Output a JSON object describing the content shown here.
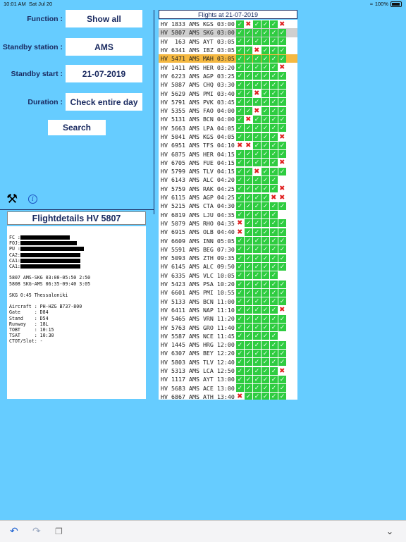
{
  "status": {
    "time": "10:01 AM",
    "date": "Sat Jul 20",
    "battery": "100%"
  },
  "form": {
    "function_label": "Function :",
    "function_value": "Show all",
    "station_label": "Standby station :",
    "station_value": "AMS",
    "start_label": "Standby start :",
    "start_value": "21-07-2019",
    "duration_label": "Duration :",
    "duration_value": "Check entire day",
    "search_label": "Search"
  },
  "icons": {
    "tools": "tools-icon",
    "info": "info-icon"
  },
  "details": {
    "title": "Flightdetails HV 5807",
    "lines": [
      {
        "text": "FC :",
        "redact": 70
      },
      {
        "text": "FOJ:",
        "redact": 80
      },
      {
        "text": "PU :",
        "redact": 90
      },
      {
        "text": "CA2:",
        "redact": 85
      },
      {
        "text": "CA1:",
        "redact": 85
      },
      {
        "text": "CA1:",
        "redact": 85
      },
      {
        "text": "",
        "redact": 0
      },
      {
        "text": "5807 AMS-SKG 03:00-05:50 2:50",
        "redact": 0
      },
      {
        "text": "5808 SKG-AMS 06:35-09:40 3:05",
        "redact": 0
      },
      {
        "text": "",
        "redact": 0
      },
      {
        "text": "SKG 0:45 Thessaloniki",
        "redact": 0
      },
      {
        "text": "",
        "redact": 0
      },
      {
        "text": "Aircraft : PH-HZG B737-800",
        "redact": 0
      },
      {
        "text": "Gate     : D84",
        "redact": 0
      },
      {
        "text": "Stand    : D54",
        "redact": 0
      },
      {
        "text": "Runway   : 18L",
        "redact": 0
      },
      {
        "text": "TOBT     : 10:15",
        "redact": 0
      },
      {
        "text": "TSAT     : 10:30",
        "redact": 0
      },
      {
        "text": "CTOT/Slot: -",
        "redact": 0
      }
    ]
  },
  "flights_header": "Flights at 21-07-2019",
  "flights": [
    {
      "t": "HV 1833 AMS KGS 03:00",
      "m": "vxvvvx",
      "hl": ""
    },
    {
      "t": "HV 5807 AMS SKG 03:00",
      "m": "vvvvvv",
      "hl": "gray"
    },
    {
      "t": "HV  163 AMS AYT 03:05",
      "m": "vvvvvv",
      "hl": ""
    },
    {
      "t": "HV 6341 AMS IBZ 03:05",
      "m": "vvxvvv",
      "hl": ""
    },
    {
      "t": "HV 5471 AMS MAH 03:05",
      "m": "vvvvvv",
      "hl": "orange"
    },
    {
      "t": "HV 1411 AMS HER 03:20",
      "m": "vvvvvx",
      "hl": ""
    },
    {
      "t": "HV 6223 AMS AGP 03:25",
      "m": "vvvvvv",
      "hl": ""
    },
    {
      "t": "HV 5887 AMS CHQ 03:30",
      "m": "vvvvvv",
      "hl": ""
    },
    {
      "t": "HV 5629 AMS PMI 03:40",
      "m": "vvxvvv",
      "hl": ""
    },
    {
      "t": "HV 5791 AMS PVK 03:45",
      "m": "vvvvvv",
      "hl": ""
    },
    {
      "t": "HV 5355 AMS FAO 04:00",
      "m": "vvxvvv",
      "hl": ""
    },
    {
      "t": "HV 5131 AMS BCN 04:00",
      "m": "vxvvvv",
      "hl": ""
    },
    {
      "t": "HV 5663 AMS LPA 04:05",
      "m": "vvvvvv",
      "hl": ""
    },
    {
      "t": "HV 5041 AMS KGS 04:05",
      "m": "vvvvvx",
      "hl": ""
    },
    {
      "t": "HV 6951 AMS TFS 04:10",
      "m": "xxvvvv",
      "hl": ""
    },
    {
      "t": "HV 6875 AMS HER 04:15",
      "m": "vvvvvv",
      "hl": ""
    },
    {
      "t": "HV 6705 AMS FUE 04:15",
      "m": "vvvvvx",
      "hl": ""
    },
    {
      "t": "HV 5799 AMS TLV 04:15",
      "m": "vvxvvv",
      "hl": ""
    },
    {
      "t": "HV 6143 AMS ALC 04:20",
      "m": "vvvvv",
      "hl": ""
    },
    {
      "t": "HV 5759 AMS RAK 04:25",
      "m": "vvvvvx",
      "hl": ""
    },
    {
      "t": "HV 6115 AMS AGP 04:25",
      "m": "vvvvxx",
      "hl": ""
    },
    {
      "t": "HV 5215 AMS CTA 04:30",
      "m": "vvvvvv",
      "hl": ""
    },
    {
      "t": "HV 6819 AMS LJU 04:35",
      "m": "vvvvv",
      "hl": ""
    },
    {
      "t": "HV 5079 AMS RHO 04:35",
      "m": "xvvvvv",
      "hl": ""
    },
    {
      "t": "HV 6915 AMS OLB 04:40",
      "m": "xvvvvv",
      "hl": ""
    },
    {
      "t": "HV 6609 AMS INN 05:05",
      "m": "vvvvvv",
      "hl": ""
    },
    {
      "t": "HV 5591 AMS BEG 07:30",
      "m": "vvvvvv",
      "hl": ""
    },
    {
      "t": "HV 5093 AMS ZTH 09:35",
      "m": "vvvvvv",
      "hl": ""
    },
    {
      "t": "HV 6145 AMS ALC 09:50",
      "m": "vvvvvv",
      "hl": ""
    },
    {
      "t": "HV 6335 AMS VLC 10:05",
      "m": "vvvvv",
      "hl": ""
    },
    {
      "t": "HV 5423 AMS PSA 10:20",
      "m": "vvvvvv",
      "hl": ""
    },
    {
      "t": "HV 6601 AMS PMI 10:55",
      "m": "vvvvvv",
      "hl": ""
    },
    {
      "t": "HV 5133 AMS BCN 11:00",
      "m": "vvvvvv",
      "hl": ""
    },
    {
      "t": "HV 6411 AMS NAP 11:10",
      "m": "vvvvvx",
      "hl": ""
    },
    {
      "t": "HV 5465 AMS VRN 11:20",
      "m": "vvvvvv",
      "hl": ""
    },
    {
      "t": "HV 5763 AMS GRO 11:40",
      "m": "vvvvvv",
      "hl": ""
    },
    {
      "t": "HV 5587 AMS NCE 11:45",
      "m": "vvvvv",
      "hl": ""
    },
    {
      "t": "HV 1445 AMS HRG 12:00",
      "m": "vvvvvv",
      "hl": ""
    },
    {
      "t": "HV 6307 AMS BEY 12:20",
      "m": "vvvvvv",
      "hl": ""
    },
    {
      "t": "HV 5803 AMS TLV 12:40",
      "m": "vvvvvv",
      "hl": ""
    },
    {
      "t": "HV 5313 AMS LCA 12:50",
      "m": "vvvvvx",
      "hl": ""
    },
    {
      "t": "HV 1117 AMS AYT 13:00",
      "m": "vvvvvv",
      "hl": ""
    },
    {
      "t": "HV 5683 AMS ACE 13:00",
      "m": "vvvvvv",
      "hl": ""
    },
    {
      "t": "HV 6867 AMS ATH 13:40",
      "m": "xvvvvv",
      "hl": ""
    }
  ],
  "toolbar": {
    "undo": "undo-icon",
    "redo": "redo-icon",
    "clipboard": "clipboard-icon",
    "chevron": "chevron-down-icon"
  }
}
